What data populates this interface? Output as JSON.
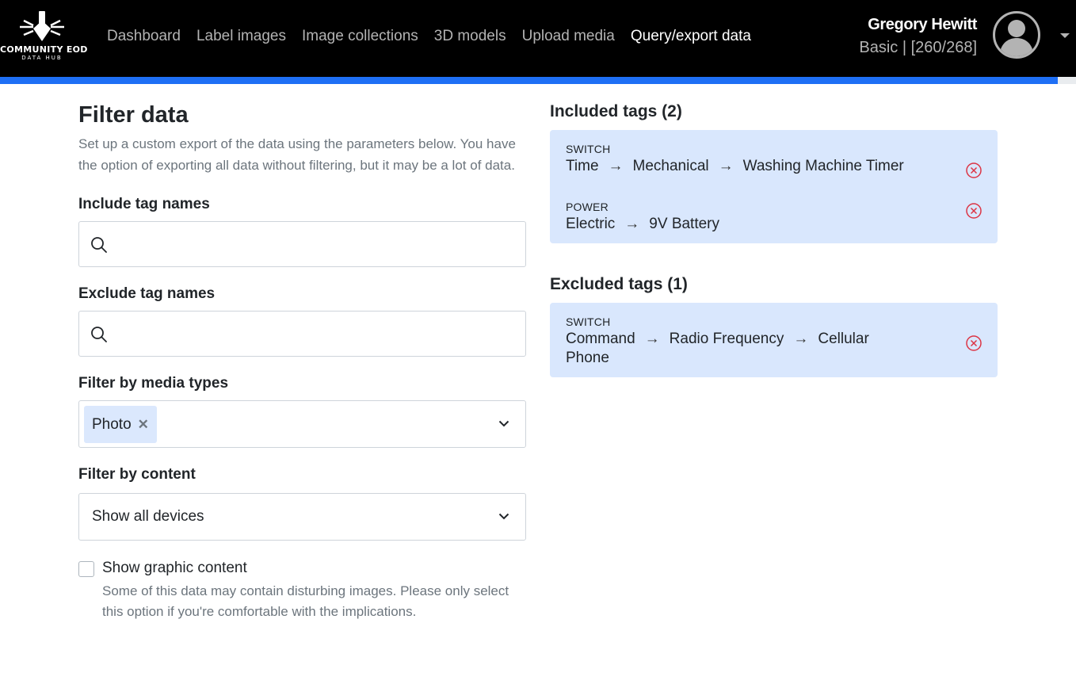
{
  "brand": {
    "name": "COMMUNITY EOD",
    "subtitle": "DATA HUB"
  },
  "nav": {
    "links": [
      "Dashboard",
      "Label images",
      "Image collections",
      "3D models",
      "Upload media",
      "Query/export data"
    ],
    "active": "Query/export data"
  },
  "user": {
    "name": "Gregory Hewitt",
    "plan": "Basic | [260/268]",
    "usage_fraction": 0.983
  },
  "filter": {
    "title": "Filter data",
    "description": "Set up a custom export of the data using the parameters below. You have the option of exporting all data without filtering, but it may be a lot of data.",
    "include_label": "Include tag names",
    "include_value": "",
    "exclude_label": "Exclude tag names",
    "exclude_value": "",
    "media_label": "Filter by media types",
    "media_selected": "Photo",
    "content_label": "Filter by content",
    "content_selected": "Show all devices",
    "graphic_label": "Show graphic content",
    "graphic_checked": false,
    "graphic_help": "Some of this data may contain disturbing images. Please only select this option if you're comfortable with the implications."
  },
  "included": {
    "title": "Included tags (2)",
    "tags": [
      {
        "category": "SWITCH",
        "path": [
          "Time",
          "Mechanical",
          "Washing Machine Timer"
        ]
      },
      {
        "category": "POWER",
        "path": [
          "Electric",
          "9V Battery"
        ]
      }
    ]
  },
  "excluded": {
    "title": "Excluded tags (1)",
    "tags": [
      {
        "category": "SWITCH",
        "path": [
          "Command",
          "Radio Frequency",
          "Cellular Phone"
        ]
      }
    ]
  },
  "icons": {
    "search": "search-icon",
    "remove": "remove-circle-icon",
    "chevron": "chevron-down-icon",
    "avatar": "user-avatar-icon"
  },
  "colors": {
    "accent": "#1e6ff5",
    "tag_bg": "#d9e7fd",
    "remove": "#dc3545",
    "navbar": "#000000"
  }
}
